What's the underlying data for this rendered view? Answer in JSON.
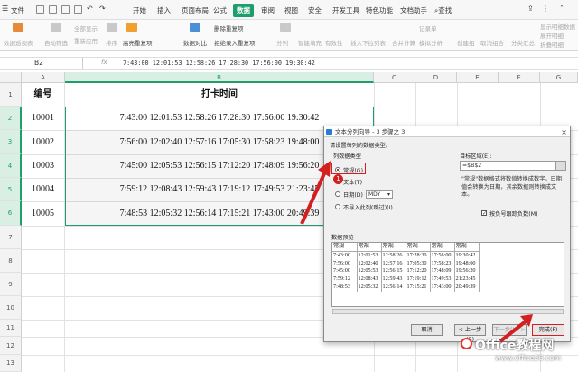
{
  "menubar": {
    "file_label": "文件",
    "tabs": [
      "开始",
      "插入",
      "页面布局",
      "公式",
      "数据",
      "审阅",
      "视图",
      "安全",
      "开发工具",
      "特色功能",
      "文档助手"
    ],
    "active_tab": "数据",
    "search_label": "查找"
  },
  "toolbar": {
    "items": [
      "数据透视表",
      "自动筛选",
      "全部显示",
      "重新应用",
      "排序",
      "高亮重复项",
      "数据对比",
      "拒绝录入重复项",
      "删除重复项",
      "分列",
      "智能填充",
      "有效性",
      "插入下拉列表",
      "合并计算",
      "模拟分析",
      "记录单",
      "创建组",
      "取消组合",
      "分类汇总",
      "展开明细",
      "折叠明细",
      "显示明细数据"
    ]
  },
  "formula_bar": {
    "cell_ref": "B2",
    "fx_label": "fx",
    "content": "7:43:00 12:01:53 12:58:26 17:28:30 17:56:00 19:30:42"
  },
  "sheet": {
    "columns": [
      "A",
      "B",
      "C",
      "D",
      "E",
      "F",
      "G"
    ],
    "rows": [
      "1",
      "2",
      "3",
      "4",
      "5",
      "6",
      "7",
      "8",
      "9",
      "10",
      "11",
      "12",
      "13"
    ],
    "header_a": "编号",
    "header_b": "打卡时间",
    "data": [
      {
        "id": "10001",
        "times": "7:43:00 12:01:53 12:58:26 17:28:30 17:56:00 19:30:42"
      },
      {
        "id": "10002",
        "times": "7:56:00 12:02:40 12:57:16 17:05:30 17:58:23 19:48:00"
      },
      {
        "id": "10003",
        "times": "7:45:00 12:05:53 12:56:15 17:12:20 17:48:09 19:56:20"
      },
      {
        "id": "10004",
        "times": "7:59:12 12:08:43 12:59:43 17:19:12 17:49:53 21:23:45"
      },
      {
        "id": "10005",
        "times": "7:48:53 12:05:32 12:56:14 17:15:21 17:43:00 20:49:39"
      }
    ]
  },
  "dialog": {
    "title": "文本分列向导 - 3 步骤之 3",
    "close_label": "×",
    "instruction": "请设置每列的数据类型。",
    "col_type_label": "列数据类型",
    "radio_general": "常规(G)",
    "radio_text": "文本(T)",
    "radio_date": "日期(D)",
    "date_format": "MDY",
    "radio_skip": "不导入此列(跳过)(I)",
    "dest_label": "目标区域(E):",
    "dest_value": "=$B$2",
    "note": "\"常规\"数据格式将数值转换成数字，日期值会转换为日期，其余数据则转换成文本。",
    "checkbox_label": "按负号跟踪负数(M)",
    "checkbox_checked": true,
    "preview_label": "数据预览",
    "preview_headers": [
      "常规",
      "常规",
      "常规",
      "常规",
      "常规",
      "常规"
    ],
    "preview_rows": [
      [
        "7:43:00",
        "12:01:53",
        "12:58:26",
        "17:28:30",
        "17:56:00",
        "19:30:42"
      ],
      [
        "7:56:00",
        "12:02:40",
        "12:57:16",
        "17:05:30",
        "17:58:23",
        "19:48:00"
      ],
      [
        "7:45:00",
        "12:05:53",
        "12:56:15",
        "17:12:20",
        "17:48:09",
        "19:56:20"
      ],
      [
        "7:59:12",
        "12:08:43",
        "12:59:43",
        "17:19:12",
        "17:49:53",
        "21:23:45"
      ],
      [
        "7:48:53",
        "12:05:32",
        "12:56:14",
        "17:15:21",
        "17:43:00",
        "20:49:39"
      ]
    ],
    "btn_cancel": "取消",
    "btn_back": "< 上一步(B)",
    "btn_next": "下一步(N) >",
    "btn_finish": "完成(F)"
  },
  "annotation": {
    "marker": "1"
  },
  "watermark": {
    "text": "Office教程网",
    "url": "www.office26.com"
  },
  "colors": {
    "accent": "#1e9e6b",
    "highlight": "#d22020"
  }
}
